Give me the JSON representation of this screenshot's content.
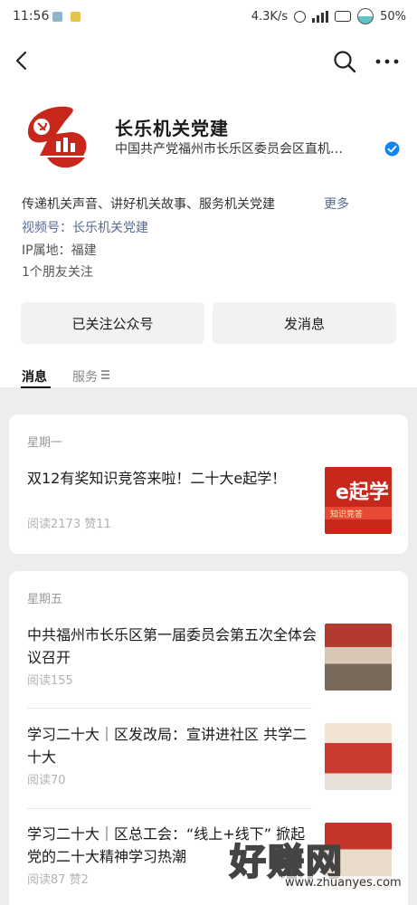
{
  "status_bar": {
    "time": "11:56",
    "net_speed": "4.3K/s",
    "battery": "50%"
  },
  "account": {
    "name": "长乐机关党建",
    "owner": "中国共产党福州市长乐区委员会区直机…",
    "description": "传递机关声音、讲好机关故事、服务机关党建",
    "more_label": "更多",
    "channel": "视频号：长乐机关党建",
    "ip_location": "IP属地：福建",
    "friends_following": "1个朋友关注"
  },
  "buttons": {
    "followed_label": "已关注公众号",
    "message_label": "发消息"
  },
  "tabs": [
    {
      "label": "消息"
    },
    {
      "label": "服务"
    }
  ],
  "groups": [
    {
      "day": "星期一",
      "articles": [
        {
          "title": "双12有奖知识竞答来啦！二十大e起学！",
          "meta": "阅读2173  赞11",
          "thumb_big": "e起学",
          "thumb_small": "知识竞答"
        }
      ]
    },
    {
      "day": "星期五",
      "articles": [
        {
          "title": "中共福州市长乐区第一届委员会第五次全体会议召开",
          "meta": "阅读155"
        },
        {
          "title": "学习二十大｜区发改局：宣讲进社区 共学二十大",
          "meta": "阅读70"
        },
        {
          "title": "学习二十大｜区总工会：“线上+线下” 掀起党的二十大精神学习热潮",
          "meta": "阅读87  赞2"
        }
      ]
    }
  ],
  "watermark": {
    "text": "好赚网",
    "url": "www.zhuanyes.com"
  },
  "colors": {
    "link": "#576b95",
    "brand_red": "#c8281c",
    "verified": "#1485ee"
  }
}
